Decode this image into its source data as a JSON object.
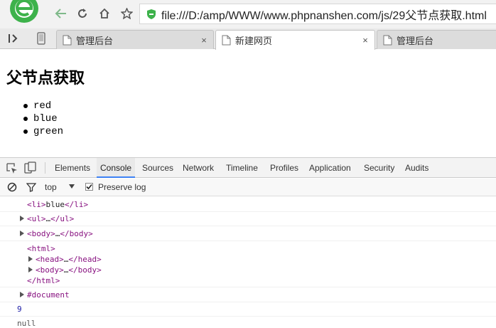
{
  "browser": {
    "url": "file:///D:/amp/WWW/www.phpnanshen.com/js/29父节点获取.html",
    "logo_icon": "browser-logo-icon",
    "accent_color": "#3db24b",
    "tabs": [
      {
        "label": "管理后台",
        "active": false
      },
      {
        "label": "新建网页",
        "active": true
      },
      {
        "label": "管理后台",
        "active": false
      }
    ],
    "tab_close_glyph": "×"
  },
  "page": {
    "heading": "父节点获取",
    "list_items": [
      "red",
      "blue",
      "green"
    ]
  },
  "devtools": {
    "tabs": [
      "Elements",
      "Console",
      "Sources",
      "Network",
      "Timeline",
      "Profiles",
      "Application",
      "Security",
      "Audits"
    ],
    "active_tab": "Console",
    "toolbar": {
      "context": "top",
      "preserve_log_label": "Preserve log",
      "preserve_log_checked": true
    },
    "console": {
      "entry_1": {
        "open": "<li>",
        "text": "blue",
        "close": "</li>"
      },
      "entry_2": {
        "open": "<ul>",
        "text": "…",
        "close": "</ul>"
      },
      "entry_3": {
        "open": "<body>",
        "text": "…",
        "close": "</body>"
      },
      "entry_4": {
        "html_open": "<html>",
        "head_open": "<head>",
        "head_text": "…",
        "head_close": "</head>",
        "body_open": "<body>",
        "body_text": "…",
        "body_close": "</body>",
        "html_close": "</html>"
      },
      "entry_5": {
        "text": "#document"
      },
      "entry_6": {
        "value": "9"
      },
      "entry_7": {
        "value": "null"
      }
    }
  }
}
